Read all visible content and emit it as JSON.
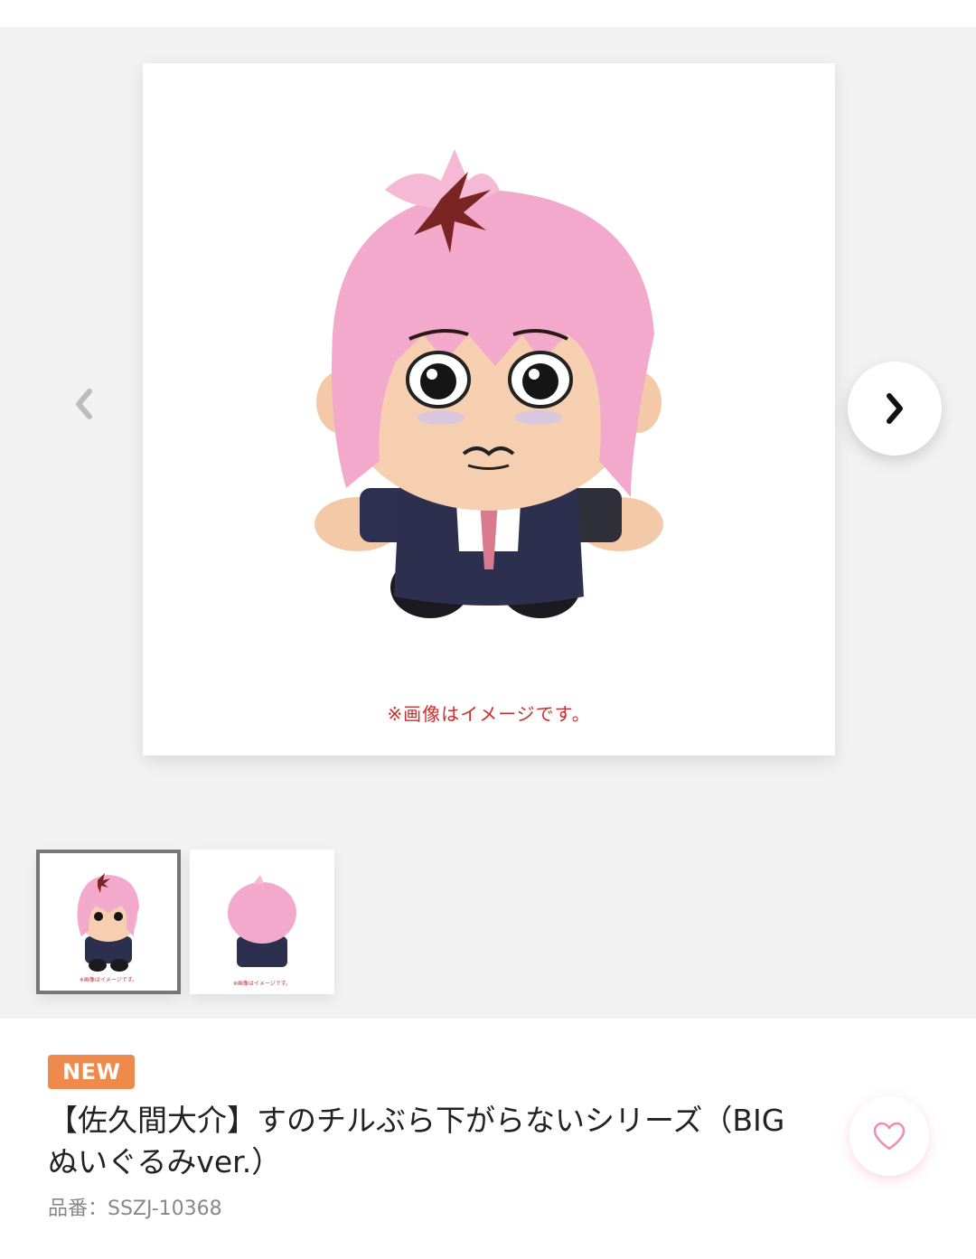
{
  "product": {
    "image_caption": "※画像はイメージです。",
    "badge": "NEW",
    "title": "【佐久間大介】すのチルぶら下がらないシリーズ（BIGぬいぐるみver.）",
    "code": "品番：SSZJ-10368"
  },
  "thumbnails": [
    {
      "caption": "※画像はイメージです。",
      "active": true
    },
    {
      "caption": "※画像はイメージです。",
      "active": false
    }
  ],
  "icons": {
    "prev": "chevron-left-icon",
    "next": "chevron-right-icon",
    "favorite": "heart-outline-icon"
  },
  "colors": {
    "badge": "#ef8a4d",
    "caption": "#d12b2b",
    "hair": "#f2a9cc"
  }
}
